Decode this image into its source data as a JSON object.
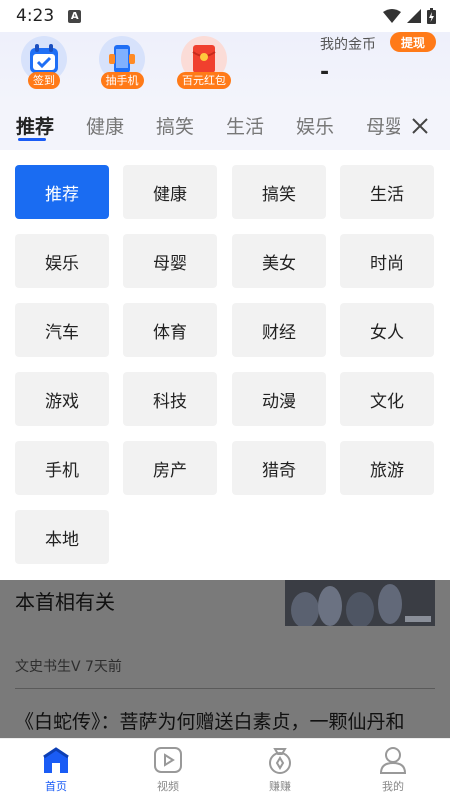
{
  "status_bar": {
    "time": "4:23",
    "notif_letter": "A"
  },
  "header": {
    "buttons": [
      {
        "label": "签到",
        "icon": "calendar-check-icon"
      },
      {
        "label": "抽手机",
        "icon": "phone-icon"
      },
      {
        "label": "百元红包",
        "icon": "red-envelope-icon"
      }
    ],
    "coin_label": "我的金币",
    "coin_value": "-",
    "withdraw_label": "提现"
  },
  "tabs": [
    "推荐",
    "健康",
    "搞笑",
    "生活",
    "娱乐",
    "母婴"
  ],
  "categories": [
    "推荐",
    "健康",
    "搞笑",
    "生活",
    "娱乐",
    "母婴",
    "美女",
    "时尚",
    "汽车",
    "体育",
    "财经",
    "女人",
    "游戏",
    "科技",
    "动漫",
    "文化",
    "手机",
    "房产",
    "猎奇",
    "旅游",
    "本地"
  ],
  "feed": {
    "title1": "本首相有关",
    "meta": "文史书生V 7天前",
    "title2": "《白蛇传》：菩萨为何赠送白素贞，一颗仙丹和"
  },
  "bottom_nav": [
    {
      "label": "首页",
      "icon": "home-icon"
    },
    {
      "label": "视频",
      "icon": "video-icon"
    },
    {
      "label": "赚赚",
      "icon": "coin-bag-icon"
    },
    {
      "label": "我的",
      "icon": "profile-icon"
    }
  ],
  "colors": {
    "accent": "#1a6cf2",
    "orange": "#ff7a18"
  }
}
